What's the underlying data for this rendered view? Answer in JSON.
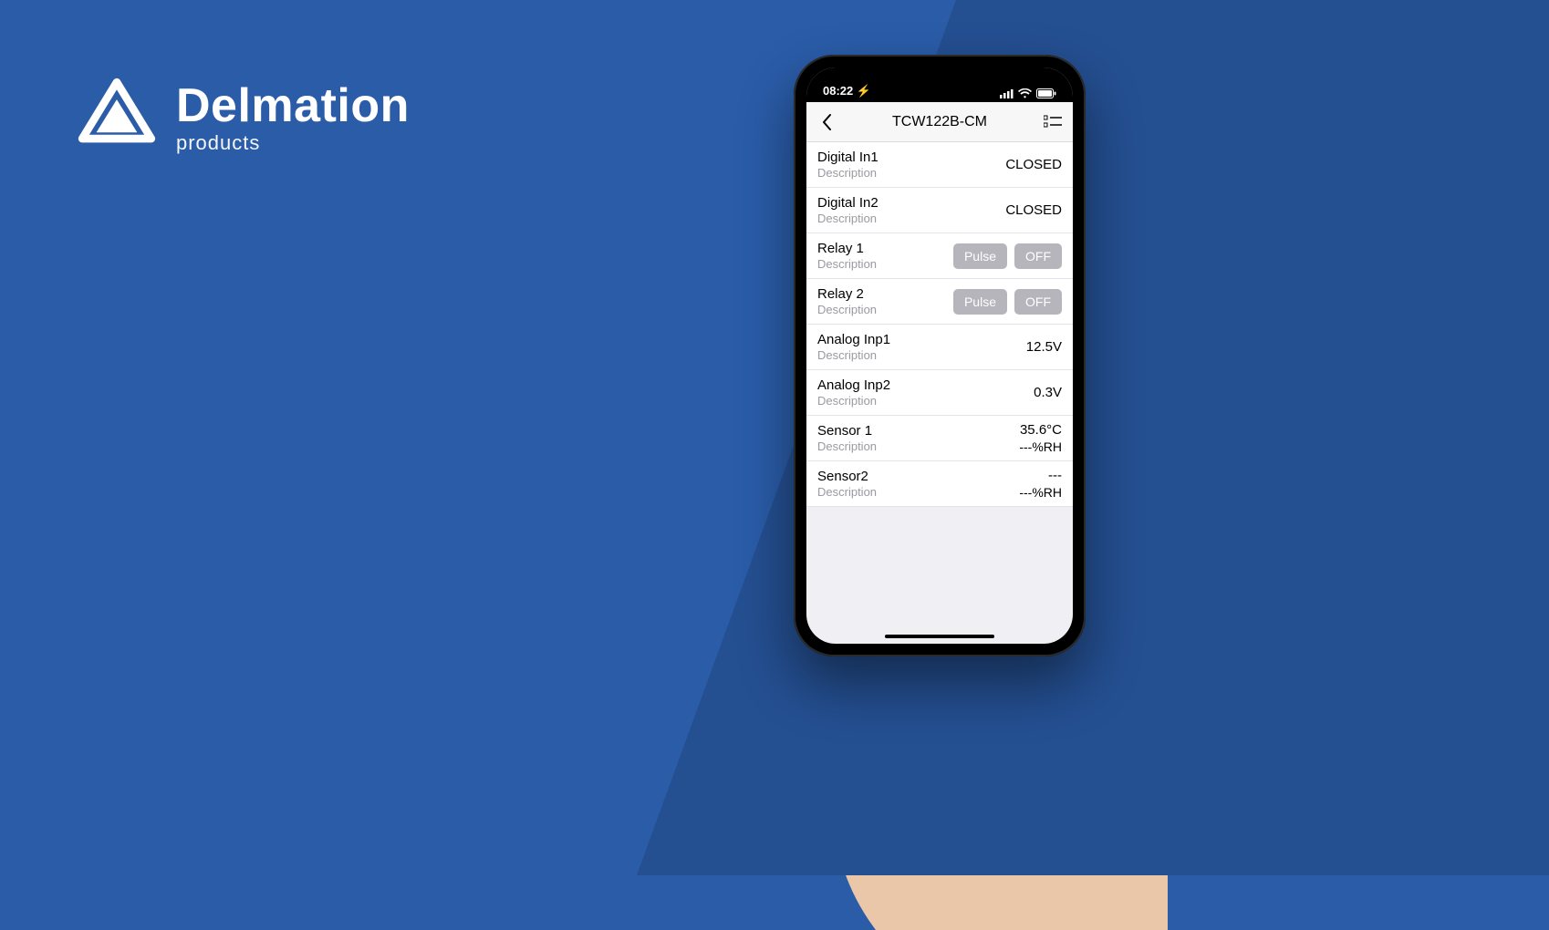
{
  "brand": {
    "name": "Delmation",
    "sub": "products"
  },
  "statusbar": {
    "time": "08:22 ⚡",
    "icons": {
      "signal": "signal-icon",
      "wifi": "wifi-icon",
      "battery": "battery-icon"
    }
  },
  "navbar": {
    "back_icon": "chevron-left-icon",
    "title": "TCW122B-CM",
    "right_icon": "list-options-icon"
  },
  "rows": [
    {
      "label": "Digital In1",
      "desc": "Description",
      "value": "CLOSED"
    },
    {
      "label": "Digital In2",
      "desc": "Description",
      "value": "CLOSED"
    },
    {
      "label": "Relay 1",
      "desc": "Description",
      "buttons": [
        "Pulse",
        "OFF"
      ]
    },
    {
      "label": "Relay 2",
      "desc": "Description",
      "buttons": [
        "Pulse",
        "OFF"
      ]
    },
    {
      "label": "Analog Inp1",
      "desc": "Description",
      "value": "12.5V"
    },
    {
      "label": "Analog Inp2",
      "desc": "Description",
      "value": "0.3V"
    },
    {
      "label": "Sensor 1",
      "desc": "Description",
      "value": "35.6°C",
      "value2": "---%RH"
    },
    {
      "label": "Sensor2",
      "desc": "Description",
      "value": "---",
      "value2": "---%RH"
    }
  ]
}
